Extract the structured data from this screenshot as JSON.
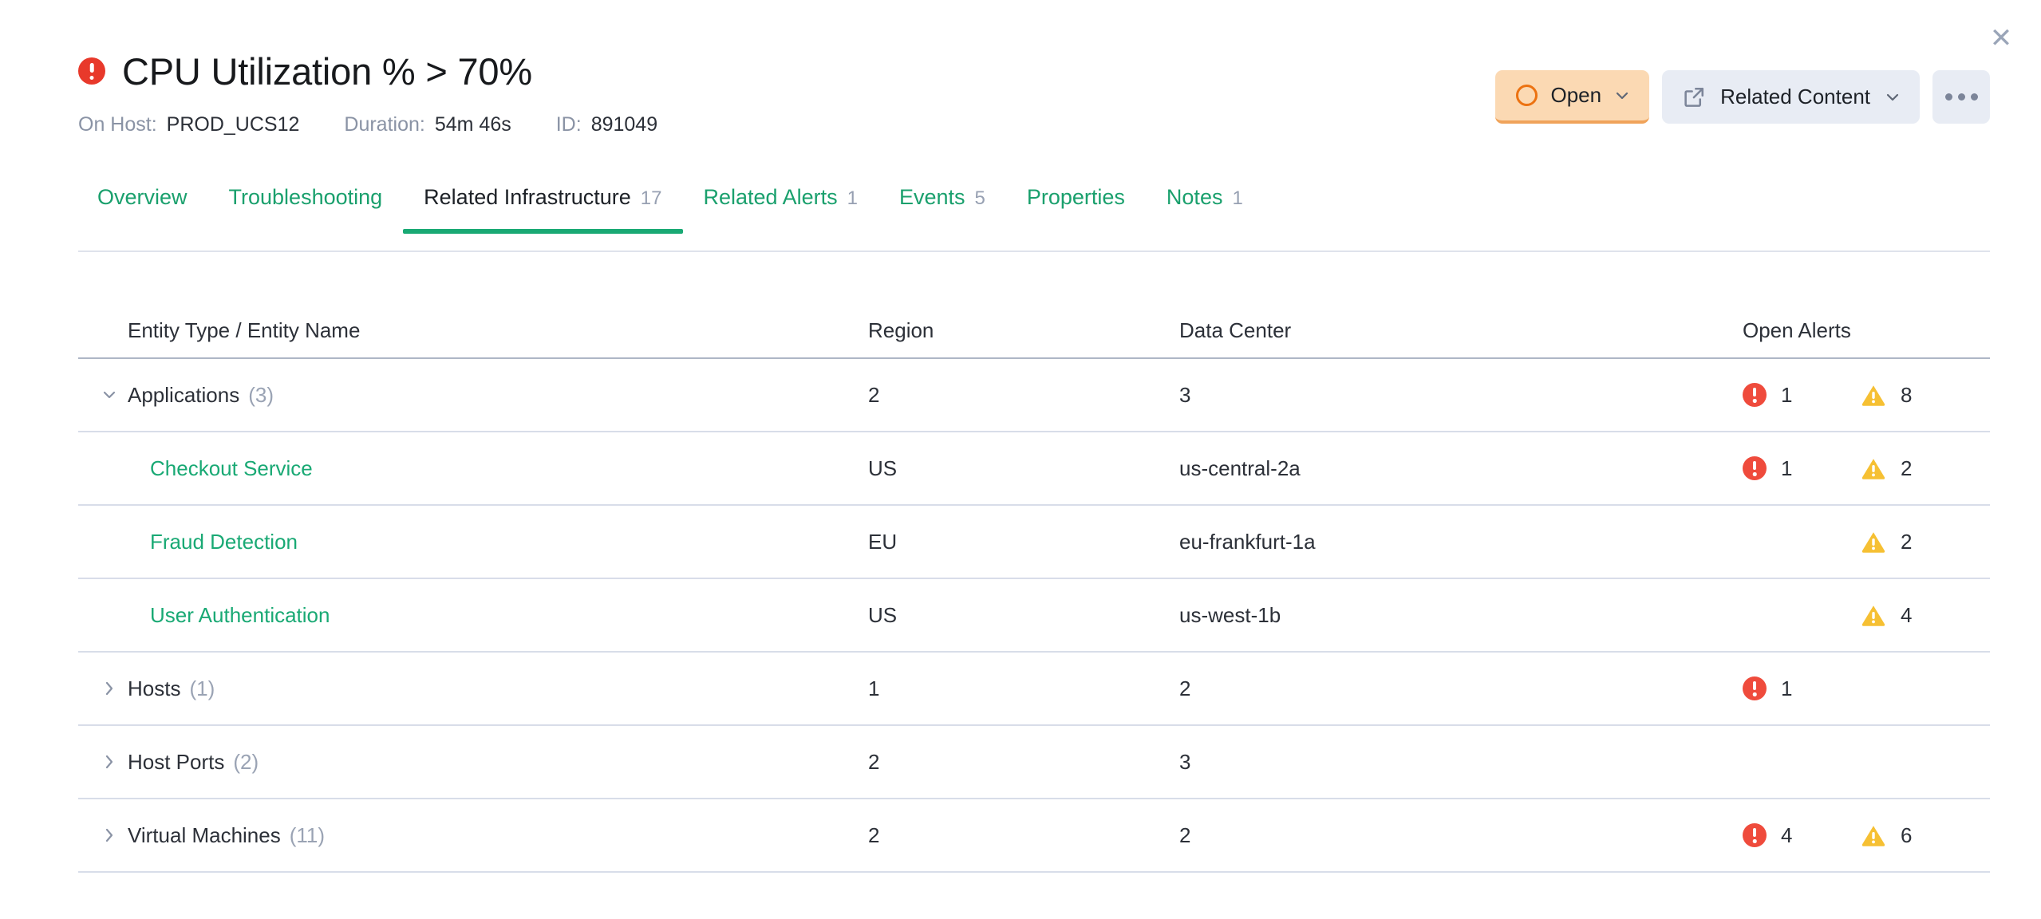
{
  "close_label": "✕",
  "header": {
    "severity_icon": "critical-circle-icon",
    "title": "CPU Utilization % > 70%",
    "meta": [
      {
        "label": "On Host:",
        "value": "PROD_UCS12"
      },
      {
        "label": "Duration:",
        "value": "54m 46s"
      },
      {
        "label": "ID:",
        "value": "891049"
      }
    ]
  },
  "actions": {
    "status_label": "Open",
    "status_icon": "circle-outline-icon",
    "related_label": "Related Content",
    "related_icon": "external-link-icon",
    "more_icon": "ellipsis-icon"
  },
  "tabs": [
    {
      "label": "Overview",
      "count": "",
      "active": false
    },
    {
      "label": "Troubleshooting",
      "count": "",
      "active": false
    },
    {
      "label": "Related Infrastructure",
      "count": "17",
      "active": true
    },
    {
      "label": "Related Alerts",
      "count": "1",
      "active": false
    },
    {
      "label": "Events",
      "count": "5",
      "active": false
    },
    {
      "label": "Properties",
      "count": "",
      "active": false
    },
    {
      "label": "Notes",
      "count": "1",
      "active": false
    }
  ],
  "table": {
    "columns": {
      "name": "Entity Type / Entity Name",
      "region": "Region",
      "data_center": "Data Center",
      "open_alerts": "Open Alerts"
    },
    "rows": [
      {
        "kind": "group",
        "expanded": true,
        "label": "Applications",
        "count": "(3)",
        "region": "2",
        "data_center": "3",
        "critical": "1",
        "warning": "8"
      },
      {
        "kind": "child",
        "expanded": false,
        "label": "Checkout Service",
        "count": "",
        "region": "US",
        "data_center": "us-central-2a",
        "critical": "1",
        "warning": "2"
      },
      {
        "kind": "child",
        "expanded": false,
        "label": "Fraud Detection",
        "count": "",
        "region": "EU",
        "data_center": "eu-frankfurt-1a",
        "critical": "",
        "warning": "2"
      },
      {
        "kind": "child",
        "expanded": false,
        "label": "User Authentication",
        "count": "",
        "region": "US",
        "data_center": "us-west-1b",
        "critical": "",
        "warning": "4"
      },
      {
        "kind": "group",
        "expanded": false,
        "label": "Hosts",
        "count": "(1)",
        "region": "1",
        "data_center": "2",
        "critical": "1",
        "warning": ""
      },
      {
        "kind": "group",
        "expanded": false,
        "label": "Host Ports",
        "count": "(2)",
        "region": "2",
        "data_center": "3",
        "critical": "",
        "warning": ""
      },
      {
        "kind": "group",
        "expanded": false,
        "label": "Virtual Machines",
        "count": "(11)",
        "region": "2",
        "data_center": "2",
        "critical": "4",
        "warning": "6"
      }
    ]
  },
  "colors": {
    "critical": "#ef4b3c",
    "warning": "#f6c033",
    "accent_green": "#19a974",
    "status_open_bg": "#fbd9b3",
    "status_open_border": "#f0a35a",
    "button_bg": "#e8ecf4"
  }
}
